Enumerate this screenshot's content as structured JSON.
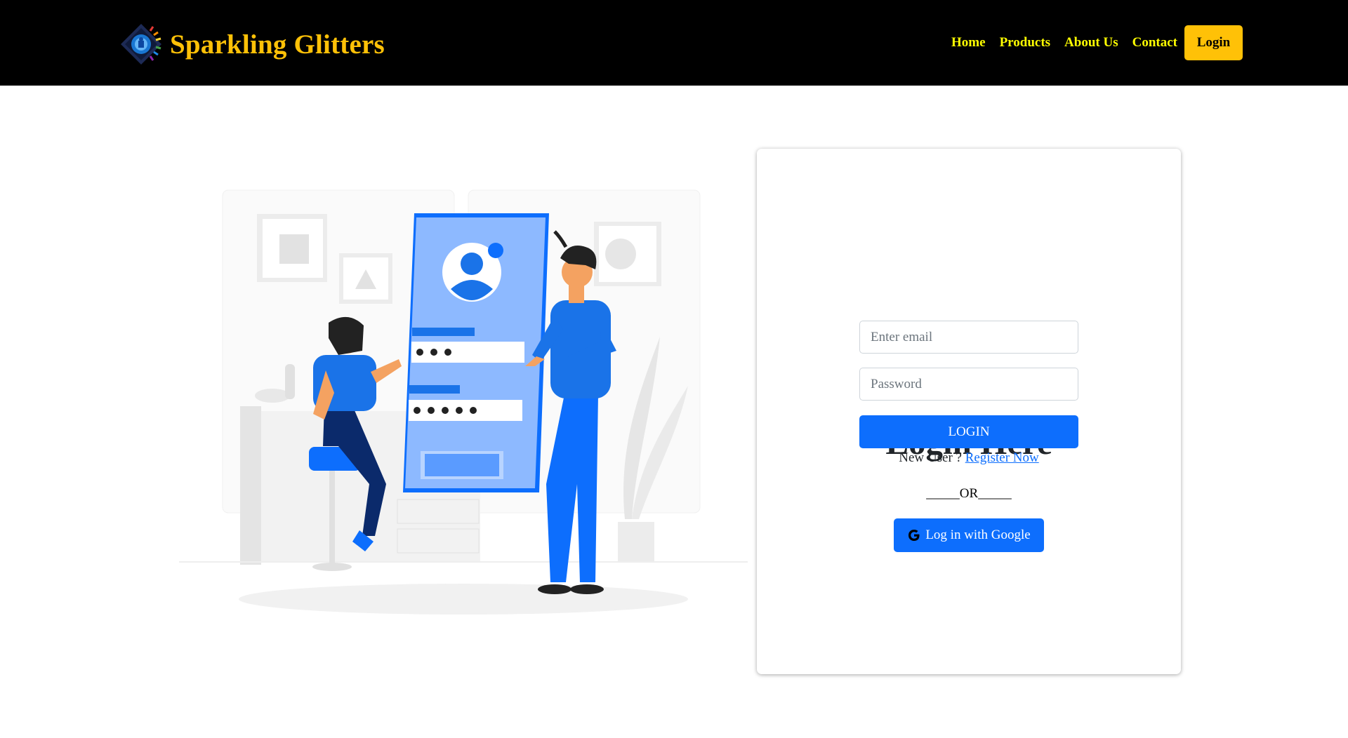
{
  "brand": {
    "name": "Sparkling Glitters",
    "logo_icon": "diamond-eye-logo"
  },
  "nav": {
    "links": [
      "Home",
      "Products",
      "About Us",
      "Contact"
    ],
    "login_label": "Login"
  },
  "login": {
    "title": "Login Here",
    "email_placeholder": "Enter email",
    "password_placeholder": "Password",
    "submit_label": "LOGIN",
    "new_user_text": "New User ? ",
    "register_label": "Register Now",
    "or_text": "_____OR_____",
    "google_label": "Log in with Google",
    "google_icon": "google-g-icon"
  },
  "colors": {
    "navbar_bg": "#000000",
    "brand": "#ffc107",
    "nav_link": "#ffff00",
    "primary": "#0d6efd"
  }
}
